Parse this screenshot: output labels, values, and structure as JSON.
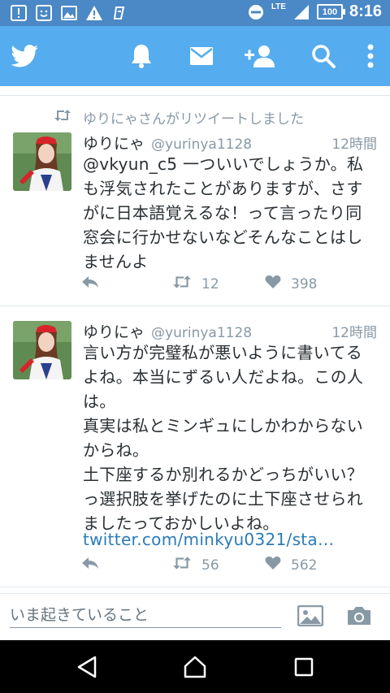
{
  "status_bar": {
    "network": "LTE",
    "battery": "100",
    "time": "8:16"
  },
  "colors": {
    "app_bar": "#55acee",
    "status_bar": "#4a88c6",
    "link": "#2b7bb9",
    "muted": "#8899a6"
  },
  "app_bar": {
    "icons": [
      "twitter-logo-icon",
      "bell-icon",
      "envelope-icon",
      "add-user-icon",
      "search-icon",
      "more-vert-icon"
    ]
  },
  "timeline": {
    "tweets": [
      {
        "retweet_context": "ゆりにゃさんがリツイートしました",
        "name": "ゆりにゃ",
        "handle": "@yurinya1128",
        "time": "12時間",
        "text": "@vkyun_c5 一ついいでしょうか。私\nも浮気されたことがありますが、さす\nがに日本語覚えるな！って言ったり同\n窓会に行かせないなどそんなことはし\nませんよ",
        "link": "",
        "retweets": "12",
        "likes": "398"
      },
      {
        "retweet_context": "",
        "name": "ゆりにゃ",
        "handle": "@yurinya1128",
        "time": "12時間",
        "text": "言い方が完璧私が悪いように書いてる\nよね。本当にずるい人だよね。この人\nは。\n真実は私とミンギュにしかわからない\nからね。\n土下座するか別れるかどっちがいい？\nっ選択肢を挙げたのに土下座させられ\nましたっておかしいよね。",
        "link": "twitter.com/minkyu0321/sta…",
        "retweets": "56",
        "likes": "562"
      }
    ]
  },
  "compose": {
    "placeholder": "いま起きていること"
  },
  "nav": {
    "icons": [
      "back-icon",
      "home-icon",
      "recents-icon"
    ]
  }
}
